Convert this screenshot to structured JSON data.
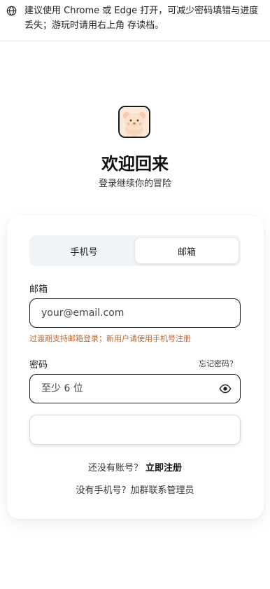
{
  "notice": {
    "text": "建议使用 Chrome 或 Edge 打开，可减少密码填错与进度丢失；游玩时请用右上角 存读档。",
    "icon": "globe-icon"
  },
  "header": {
    "logo_icon": "bear-avatar",
    "title": "欢迎回来",
    "subtitle": "登录继续你的冒险"
  },
  "tabs": [
    {
      "label": "手机号",
      "active": false
    },
    {
      "label": "邮箱",
      "active": true
    }
  ],
  "form": {
    "email_label": "邮箱",
    "email_value": "",
    "email_placeholder": "your@email.com",
    "email_hint": "过渡期支持邮箱登录；新用户请使用手机号注册",
    "password_label": "密码",
    "forgot_label": "忘记密码？",
    "password_value": "",
    "password_placeholder": "至少 6 位",
    "submit_label": ""
  },
  "footer": {
    "no_account_text": "还没有账号？",
    "register_link": "立即注册",
    "no_phone_text": "没有手机号？加群联系管理员"
  },
  "colors": {
    "accent": "#111111",
    "hint": "#b06a3a",
    "tab_bg": "#f1f4f7",
    "logo_bg": "#fde9dc"
  }
}
